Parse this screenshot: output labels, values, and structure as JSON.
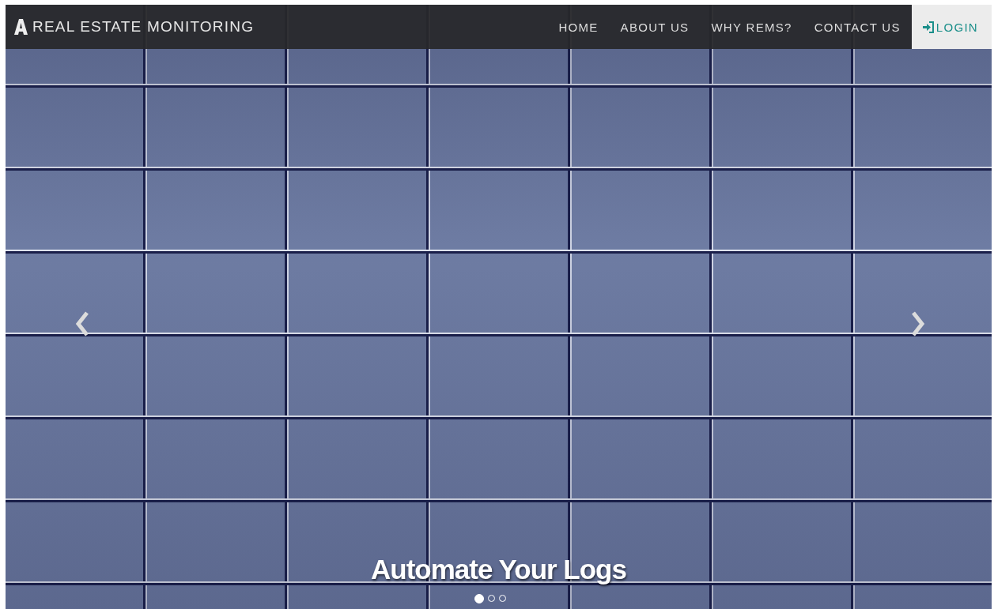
{
  "navbar": {
    "brand": "REAL ESTATE MONITORING",
    "items": [
      {
        "label": "HOME",
        "kind": "link"
      },
      {
        "label": "ABOUT US",
        "kind": "link"
      },
      {
        "label": "WHY REMS?",
        "kind": "link"
      },
      {
        "label": "CONTACT US",
        "kind": "link"
      },
      {
        "label": "LOGIN",
        "kind": "login"
      }
    ]
  },
  "carousel": {
    "caption": "Automate Your Logs",
    "indicators": [
      {
        "selected": true
      },
      {
        "selected": false
      },
      {
        "selected": false
      }
    ]
  }
}
